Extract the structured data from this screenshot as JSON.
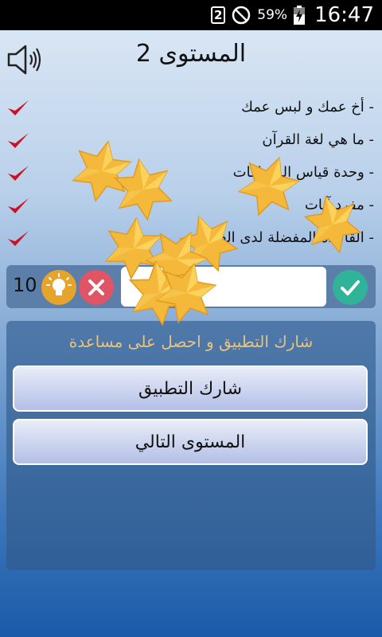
{
  "status_bar": {
    "sim_label": "2",
    "battery_percent": "59%",
    "time": "16:47",
    "icons": [
      "sim-2-icon",
      "do-not-disturb-icon",
      "battery-charging-icon"
    ]
  },
  "header": {
    "title": "المستوى 2",
    "sound_icon": "speaker-icon"
  },
  "answers": [
    {
      "text": "- أخ عمك و لبس عمك",
      "icon": "check-icon"
    },
    {
      "text": "- ما هي لغة القرآن",
      "icon": "check-icon"
    },
    {
      "text": "- وحدة قياس المسافات",
      "icon": "check-icon"
    },
    {
      "text": "- مفرد آيات",
      "icon": "check-icon"
    },
    {
      "text": "- القاعدة المفضلة لدى الفرنسي",
      "icon": "check-icon"
    }
  ],
  "input_bar": {
    "hint_count": "10",
    "hint_icon": "lightbulb-icon",
    "clear_icon": "close-icon",
    "confirm_icon": "check-icon",
    "answer_value": ""
  },
  "help_panel": {
    "heading": "شارك التطبيق و احصل على مساعدة",
    "share_button": "شارك التطبيق",
    "next_level_button": "المستوى التالي"
  },
  "colors": {
    "hint_button": "#e7a42a",
    "clear_button": "#e05566",
    "confirm_button": "#2fb49a",
    "check_mark": "#cc1122",
    "panel_heading": "#e8c37c",
    "star_fill": "#f4b93a"
  }
}
